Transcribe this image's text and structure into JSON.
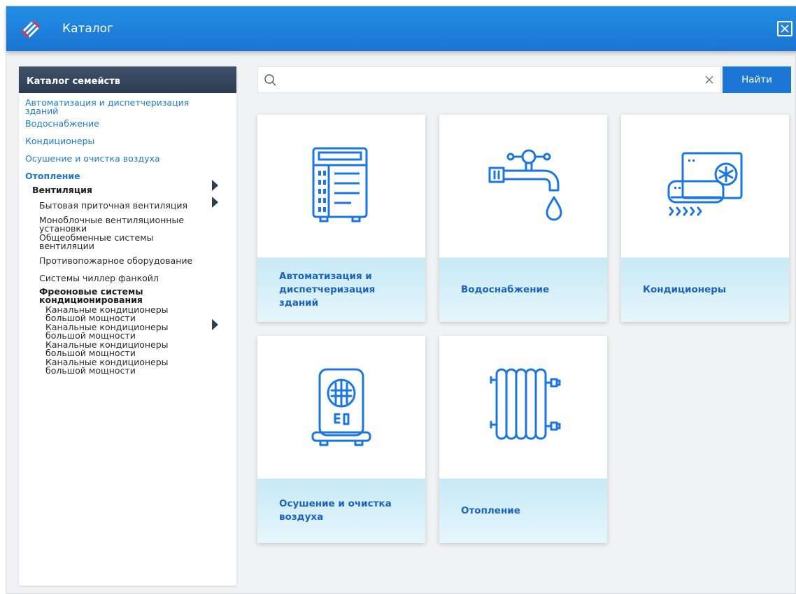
{
  "window": {
    "title": "Каталог",
    "close_icon": "close-icon"
  },
  "sidebar": {
    "header": "Каталог семейств",
    "level1": [
      {
        "label": "Автоматизация и диспетчеризация зданий"
      },
      {
        "label": "Водоснабжение"
      },
      {
        "label": "Кондиционеры"
      },
      {
        "label": "Осушение и очистка воздуха"
      },
      {
        "label": "Отопление"
      }
    ],
    "level2": [
      {
        "label": "Вентиляция"
      }
    ],
    "level3": [
      {
        "label": "Бытовая приточная вентиляция"
      },
      {
        "label": "Моноблочные вентиляционные установки"
      },
      {
        "label": "Общеобменные системы вентиляции"
      },
      {
        "label": "Противопожарное оборудование"
      },
      {
        "label": "Системы чиллер фанкойл"
      },
      {
        "label": "Фреоновые системы кондиционирования"
      }
    ],
    "level4": [
      {
        "label": "Канальные кондиционеры большой мощности"
      },
      {
        "label": "Канальные кондиционеры большой мощности"
      },
      {
        "label": "Канальные кондиционеры большой мощности"
      },
      {
        "label": "Канальные кондиционеры большой мощности"
      }
    ]
  },
  "search": {
    "placeholder": "",
    "value": "",
    "button_label": "Найти"
  },
  "cards": [
    {
      "label": "Автоматизация и диспетчеризация зданий",
      "icon": "automation-cabinet-icon"
    },
    {
      "label": "Водоснабжение",
      "icon": "water-tap-icon"
    },
    {
      "label": "Кондиционеры",
      "icon": "air-conditioner-icon"
    },
    {
      "label": "Осушение и очистка воздуха",
      "icon": "air-purifier-icon"
    },
    {
      "label": "Отопление",
      "icon": "radiator-icon"
    }
  ],
  "colors": {
    "accent": "#1b76d6",
    "titlebar": "#1a75d3",
    "sidebar_header": "#2d3c52",
    "link": "#1d7ad6",
    "card_label_bg": "#d6f0f8",
    "card_label_text": "#1b63c2",
    "icon": "#1b76e0"
  }
}
